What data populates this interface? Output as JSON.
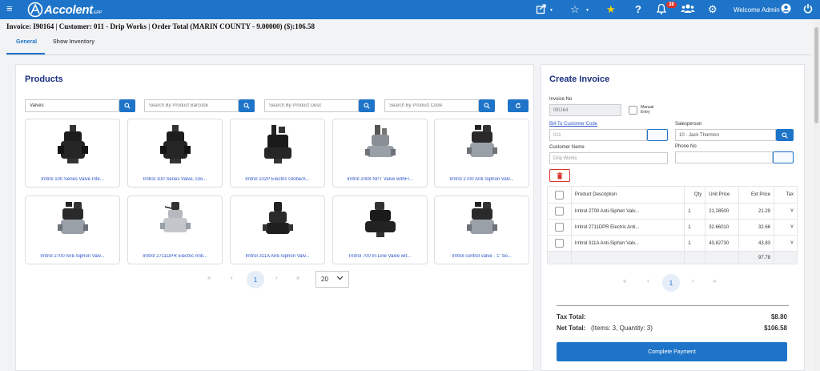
{
  "app": {
    "logo_text": "Accolent",
    "logo_sub": "ERP",
    "notification_count": "38",
    "welcome": "Welcome Admin",
    "brand_color": "#1e74c8"
  },
  "invoice_header": "Invoice: I90164 | Customer: 011 - Drip Works | Order Total (MARIN COUNTY - 9.00000) ($):106.58",
  "tabs": [
    {
      "label": "General",
      "active": true
    },
    {
      "label": "Show Inventory",
      "active": false
    }
  ],
  "products": {
    "title": "Products",
    "search": {
      "category_value": "Valves",
      "barcode_placeholder": "Search By Product Barcode",
      "desc_placeholder": "Search By Product Desc",
      "code_placeholder": "Search By Product Code"
    },
    "items": [
      {
        "name": "Irritrol 100 Series Valve Inte...",
        "icon": "black-valve-image"
      },
      {
        "name": "Irritrol 100 Series Valve, Glo...",
        "icon": "black-valve-image"
      },
      {
        "name": "Irritrol 102P Electric Globe/A...",
        "icon": "black-valve-image"
      },
      {
        "name": "Irritrol 2008 NPT Valve withFl...",
        "icon": "gray-valve-image"
      },
      {
        "name": "Irritrol 2700 Anti-Siphon Valv...",
        "icon": "gray-valve-image"
      },
      {
        "name": "Irritrol 2700 Anti-Siphon Valv...",
        "icon": "gray-valve-image"
      },
      {
        "name": "Irritrol 2711DPR Electric Anti...",
        "icon": "gray-valve-image"
      },
      {
        "name": "Irritrol 311A Anti-Siphon Valv...",
        "icon": "black-valve-image"
      },
      {
        "name": "Irritrol 700 In-Line Valve wit...",
        "icon": "black-valve-image"
      },
      {
        "name": "Irritrol control valve - 1\" bo...",
        "icon": "gray-valve-image"
      }
    ],
    "pager": {
      "first": "«",
      "prev": "‹",
      "current": "1",
      "next": "›",
      "last": "»",
      "page_size": "20"
    }
  },
  "create_invoice": {
    "title": "Create Invoice",
    "invoice_no_label": "Invoice No",
    "invoice_no_value": "I90164",
    "manual_entry_label": "Manual Entry",
    "bill_to_label": "Bill-To Customer Code",
    "bill_to_value": "011",
    "salesperson_label": "Salesperson",
    "salesperson_value": "10 - Jack Thornton",
    "customer_name_label": "Customer Name",
    "customer_name_value": "Drip Works",
    "phone_label": "Phone No",
    "phone_value": "",
    "columns": [
      "Product Description",
      "Qty",
      "Unit Price",
      "Ext Price",
      "Tax"
    ],
    "rows": [
      {
        "desc": "Irritrol 2700 Anti-Siphon Valv...",
        "qty": "1",
        "unit": "21.28500",
        "ext": "21.29",
        "tax": "Y"
      },
      {
        "desc": "Irritrol 2711DPR Electric Anti...",
        "qty": "1",
        "unit": "32.66010",
        "ext": "32.66",
        "tax": "Y"
      },
      {
        "desc": "Irritrol 311A Anti-Siphon Valv...",
        "qty": "1",
        "unit": "43.82730",
        "ext": "43.83",
        "tax": "Y"
      }
    ],
    "ext_total": "97.78",
    "pager": {
      "first": "«",
      "prev": "‹",
      "current": "1",
      "next": "›",
      "last": "»"
    },
    "tax_total_label": "Tax Total:",
    "tax_total_value": "$8.80",
    "net_total_label": "Net Total:",
    "net_total_detail": "(Items: 3, Quantity: 3)",
    "net_total_value": "$106.58",
    "complete_button": "Complete Payment"
  }
}
